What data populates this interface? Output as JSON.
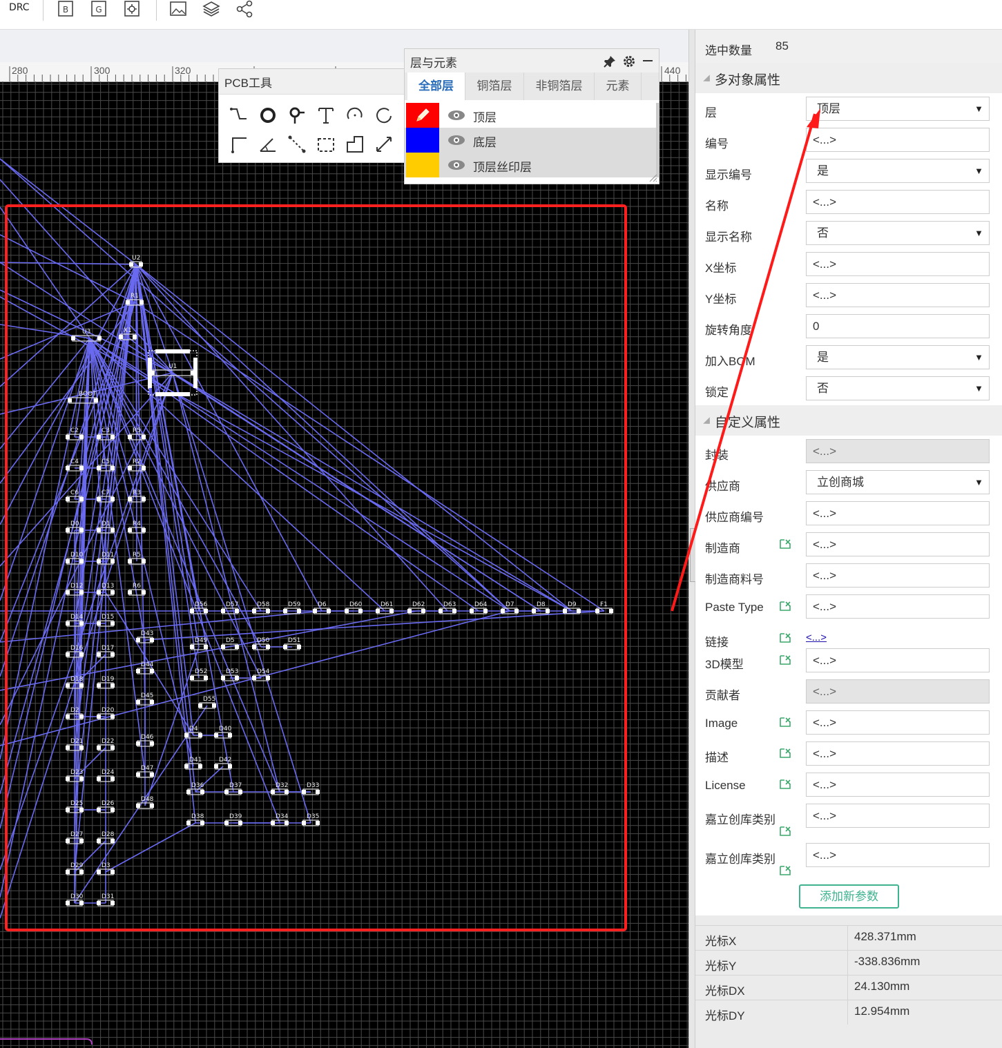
{
  "toolbar": {
    "drc_label": "DRC",
    "icons": [
      "bom-icon",
      "gerber-icon",
      "pick-place-icon",
      "image-export-icon",
      "layers-icon",
      "share-icon"
    ]
  },
  "ruler": {
    "ticks": [
      "280",
      "300",
      "320",
      "440"
    ]
  },
  "pcb_tools": {
    "title": "PCB工具",
    "tools": [
      "track-icon",
      "pad-icon",
      "via-icon",
      "text-icon",
      "arc-icon",
      "circle-arc-icon",
      "line-icon",
      "angle-icon",
      "connect-icon",
      "dashed-rect-icon",
      "solid-region-icon",
      "measure-icon"
    ]
  },
  "layers_panel": {
    "title": "层与元素",
    "tabs": [
      "全部层",
      "铜箔层",
      "非铜箔层",
      "元素"
    ],
    "active_tab": "全部层",
    "layers": [
      {
        "name": "顶层",
        "color": "#ff0000",
        "active": true
      },
      {
        "name": "底层",
        "color": "#0000ff",
        "active": false
      },
      {
        "name": "顶层丝印层",
        "color": "#ffcc00",
        "active": false
      }
    ]
  },
  "pcb_labels": {
    "U2": "U2",
    "R1": "R1",
    "U1": "U1",
    "BOOT": "BOOT",
    "row_d": [
      "D56",
      "D57",
      "D58",
      "D59",
      "D6",
      "D60",
      "D61",
      "D62",
      "D63",
      "D64",
      "D7",
      "D8",
      "D9",
      "F1"
    ]
  },
  "properties": {
    "selected_count_label": "选中数量",
    "selected_count": "85",
    "multi_section": "多对象属性",
    "rows": [
      {
        "label": "层",
        "value": "顶层",
        "type": "select"
      },
      {
        "label": "编号",
        "value": "<...>",
        "type": "input"
      },
      {
        "label": "显示编号",
        "value": "是",
        "type": "select"
      },
      {
        "label": "名称",
        "value": "<...>",
        "type": "input"
      },
      {
        "label": "显示名称",
        "value": "否",
        "type": "select"
      },
      {
        "label": "X坐标",
        "value": "<...>",
        "type": "input"
      },
      {
        "label": "Y坐标",
        "value": "<...>",
        "type": "input"
      },
      {
        "label": "旋转角度",
        "value": "0",
        "type": "input"
      },
      {
        "label": "加入BOM",
        "value": "是",
        "type": "select"
      },
      {
        "label": "锁定",
        "value": "否",
        "type": "select"
      }
    ],
    "custom_section": "自定义属性",
    "custom_rows": [
      {
        "label": "封装",
        "value": "<...>",
        "type": "disabled",
        "icon": false
      },
      {
        "label": "供应商",
        "value": "立创商城",
        "type": "select",
        "icon": false
      },
      {
        "label": "供应商编号",
        "value": "<...>",
        "type": "input",
        "icon": false
      },
      {
        "label": "制造商",
        "value": "<...>",
        "type": "input",
        "icon": true
      },
      {
        "label": "制造商料号",
        "value": "<...>",
        "type": "input",
        "icon": false
      },
      {
        "label": "Paste Type",
        "value": "<...>",
        "type": "input",
        "icon": true
      },
      {
        "label": "链接",
        "value": "<...>",
        "type": "link",
        "icon": true
      },
      {
        "label": "3D模型",
        "value": "<...>",
        "type": "input",
        "icon": true
      },
      {
        "label": "贡献者",
        "value": "<...>",
        "type": "disabled",
        "icon": false
      },
      {
        "label": "Image",
        "value": "<...>",
        "type": "input",
        "icon": true
      },
      {
        "label": "描述",
        "value": "<...>",
        "type": "input",
        "icon": true
      },
      {
        "label": "License",
        "value": "<...>",
        "type": "input",
        "icon": true
      },
      {
        "label": "嘉立创库类别",
        "value": "<...>",
        "type": "input",
        "icon": true
      },
      {
        "label": "嘉立创库类别",
        "value": "<...>",
        "type": "input",
        "icon": true
      }
    ],
    "add_param_label": "添加新参数"
  },
  "status": {
    "rows": [
      {
        "label": "光标X",
        "value": "428.371mm"
      },
      {
        "label": "光标Y",
        "value": "-338.836mm"
      },
      {
        "label": "光标DX",
        "value": "24.130mm"
      },
      {
        "label": "光标DY",
        "value": "12.954mm"
      }
    ]
  },
  "colors": {
    "selection_box": "#ff2020",
    "ratsnest": "#6a6af0",
    "annotation_arrow": "#ff1a1a",
    "accent_green": "#3fb28f",
    "tab_active": "#2a6ebb"
  }
}
